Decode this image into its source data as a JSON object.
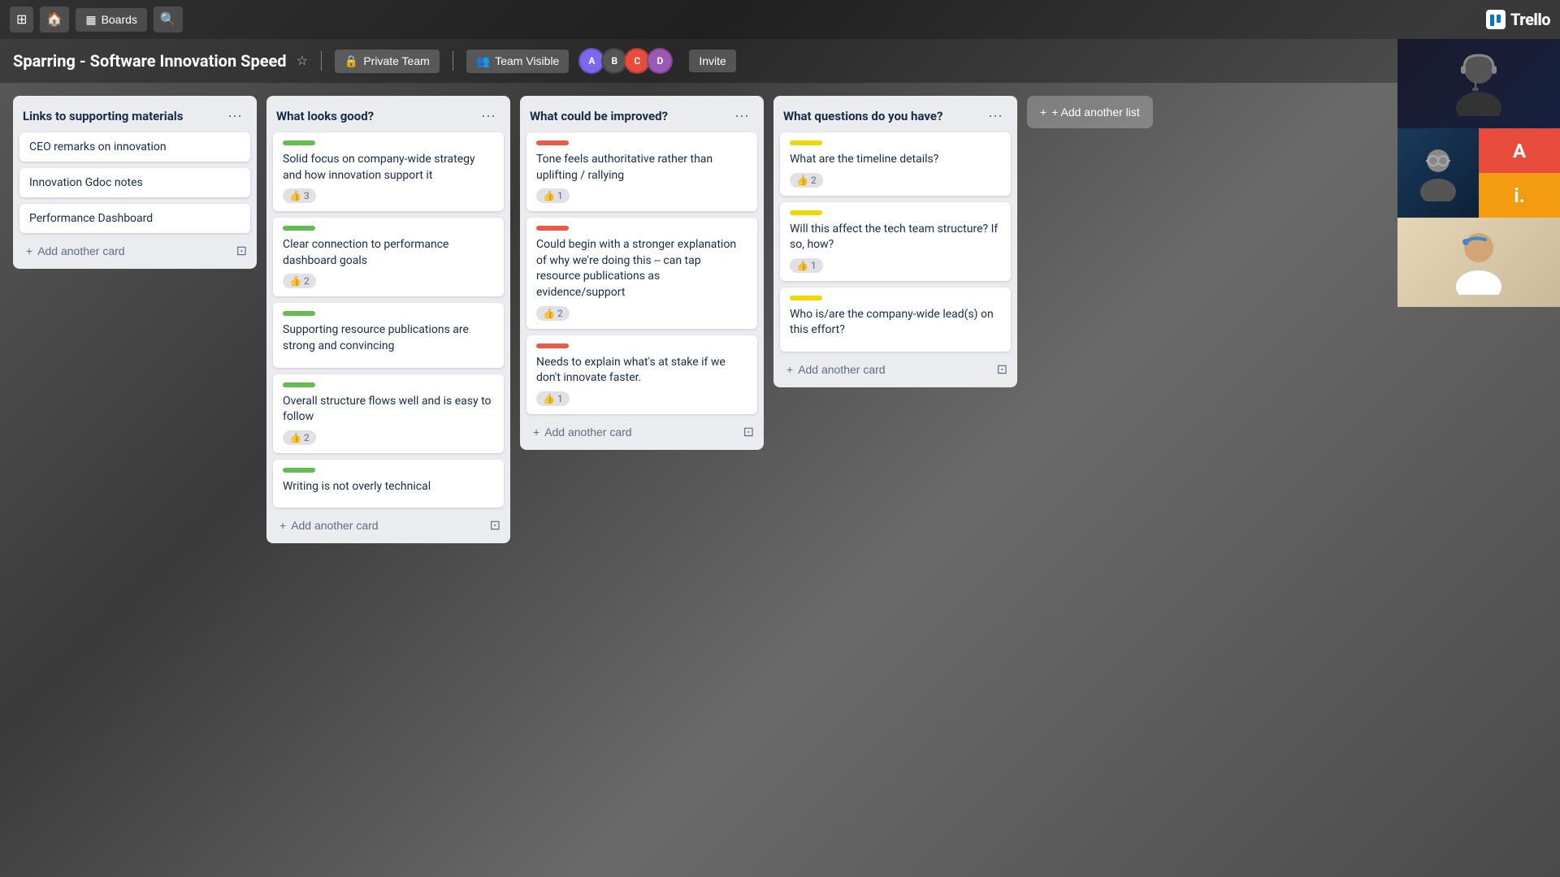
{
  "topnav": {
    "home_label": "🏠",
    "boards_label": "Boards",
    "search_label": "🔍",
    "brand_label": "Trello"
  },
  "board": {
    "title": "Sparring - Software Innovation Speed",
    "visibility": "Private Team",
    "team_visible": "Team Visible",
    "invite_label": "Invite",
    "add_list_label": "+ Add another list"
  },
  "lists": [
    {
      "id": "links",
      "title": "Links to supporting materials",
      "cards": [
        {
          "id": "l1",
          "text": "CEO remarks on innovation",
          "type": "simple"
        },
        {
          "id": "l2",
          "text": "Innovation Gdoc notes",
          "type": "simple"
        },
        {
          "id": "l3",
          "text": "Performance Dashboard",
          "type": "simple"
        }
      ],
      "add_label": "Add another card"
    },
    {
      "id": "good",
      "title": "What looks good?",
      "cards": [
        {
          "id": "g1",
          "label": "green",
          "text": "Solid focus on company-wide strategy and how innovation support it",
          "badge": 3
        },
        {
          "id": "g2",
          "label": "green",
          "text": "Clear connection to performance dashboard goals",
          "badge": 2
        },
        {
          "id": "g3",
          "label": "green",
          "text": "Supporting resource publications are strong and convincing",
          "badge": null
        },
        {
          "id": "g4",
          "label": "green",
          "text": "Overall structure flows well and is easy to follow",
          "badge": 2
        },
        {
          "id": "g5",
          "label": "green",
          "text": "Writing is not overly technical",
          "badge": null
        }
      ],
      "add_label": "Add another card"
    },
    {
      "id": "improved",
      "title": "What could be improved?",
      "cards": [
        {
          "id": "i1",
          "label": "red",
          "text": "Tone feels authoritative rather than uplifting / rallying",
          "badge": 1
        },
        {
          "id": "i2",
          "label": "red",
          "text": "Could begin with a stronger explanation of why we're doing this -- can tap resource publications as evidence/support",
          "badge": 2
        },
        {
          "id": "i3",
          "label": "red",
          "text": "Needs to explain what's at stake if we don't innovate faster.",
          "badge": 1
        }
      ],
      "add_label": "Add another card"
    },
    {
      "id": "questions",
      "title": "What questions do you have?",
      "cards": [
        {
          "id": "q1",
          "label": "yellow",
          "text": "What are the timeline details?",
          "badge": 2
        },
        {
          "id": "q2",
          "label": "yellow",
          "text": "Will this affect the tech team structure? If so, how?",
          "badge": 1
        },
        {
          "id": "q3",
          "label": "yellow",
          "text": "Who is/are the company-wide lead(s) on this effort?",
          "badge": null
        }
      ],
      "add_label": "Add another card"
    }
  ],
  "avatars": [
    {
      "color": "#7B68EE",
      "letter": "A"
    },
    {
      "color": "#2ecc71",
      "letter": "B"
    },
    {
      "color": "#e74c3c",
      "letter": "C"
    },
    {
      "color": "#9b59b6",
      "letter": "D"
    }
  ]
}
